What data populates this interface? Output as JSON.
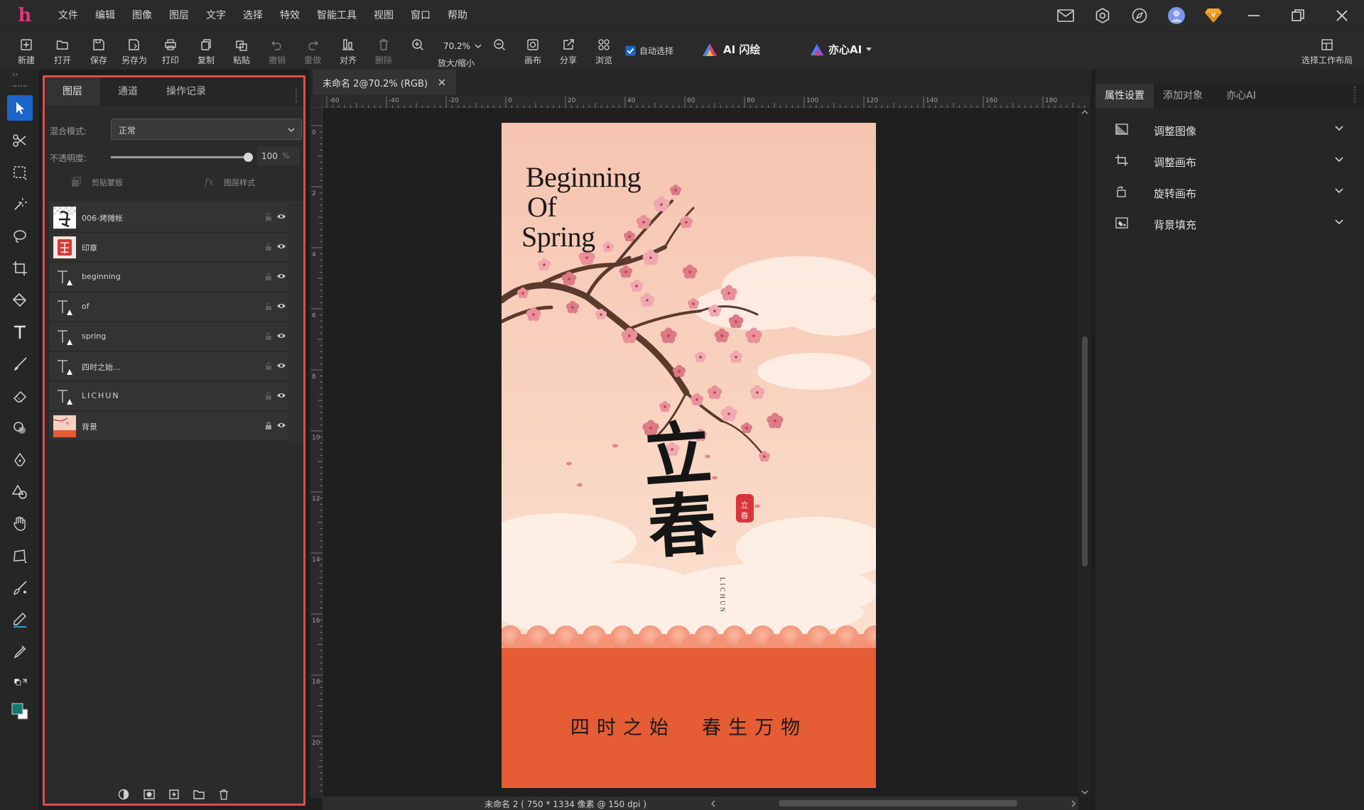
{
  "app": {
    "logo_text": "h"
  },
  "menu": [
    "文件",
    "编辑",
    "图像",
    "图层",
    "文字",
    "选择",
    "特效",
    "智能工具",
    "视图",
    "窗口",
    "帮助"
  ],
  "toolbar": {
    "new": "新建",
    "open": "打开",
    "save": "保存",
    "save_as": "另存为",
    "print": "打印",
    "copy": "复制",
    "paste": "粘贴",
    "undo": "撤销",
    "redo": "重做",
    "align": "对齐",
    "delete": "删除",
    "zoom_value": "70.2%",
    "zoom_label": "放大/缩小",
    "canvas": "画布",
    "share": "分享",
    "browse": "浏览",
    "auto_select": "自动选择",
    "ai_flash": "AI 闪绘",
    "yixin_ai": "亦心AI",
    "layout": "选择工作布局"
  },
  "layers_panel": {
    "tabs": [
      "图层",
      "通道",
      "操作记录"
    ],
    "blend_label": "混合模式:",
    "blend_value": "正常",
    "opacity_label": "不透明度:",
    "opacity_value": "100",
    "opacity_unit": "%",
    "opacity_fraction": 1.0,
    "clip_mask": "剪贴蒙版",
    "layer_style": "图层样式",
    "layers": [
      {
        "name": "006-烤摊帐",
        "kind": "image"
      },
      {
        "name": "印章",
        "kind": "image"
      },
      {
        "name": "beginning",
        "kind": "text"
      },
      {
        "name": "of",
        "kind": "text"
      },
      {
        "name": "spring",
        "kind": "text"
      },
      {
        "name": "四时之始...",
        "kind": "text"
      },
      {
        "name": "LICHUN",
        "kind": "text"
      },
      {
        "name": "背景",
        "kind": "image"
      }
    ]
  },
  "document": {
    "tab_title": "未命名 2@70.2% (RGB)",
    "status": "未命名 2 ( 750 * 1334 像素 @ 150 dpi )",
    "ruler_top": [
      "-60",
      "-40",
      "-20",
      "0",
      "20",
      "40",
      "60",
      "80",
      "100",
      "120",
      "140",
      "160",
      "180"
    ],
    "ruler_left": [
      "0",
      "2",
      "4",
      "6",
      "8",
      "10",
      "12",
      "14",
      "16",
      "18",
      "20"
    ]
  },
  "artwork": {
    "title_lines": [
      "Beginning",
      "Of",
      "Spring"
    ],
    "calligraphy": "立春",
    "seal": "立春",
    "vertical": "LICHUN",
    "slogan": "四时之始  春生万物",
    "colors": {
      "sky_top": "#f6c6b3",
      "sky_bottom": "#fbe6d6",
      "ground": "#e55c35",
      "text": "#1a1a1a"
    }
  },
  "right_panel": {
    "tabs": [
      "属性设置",
      "添加对象",
      "亦心AI"
    ],
    "items": [
      "调整图像",
      "调整画布",
      "旋转画布",
      "背景填充"
    ]
  },
  "colors": {
    "accent": "#1c66c9",
    "highlight_border": "#e24b4b"
  }
}
